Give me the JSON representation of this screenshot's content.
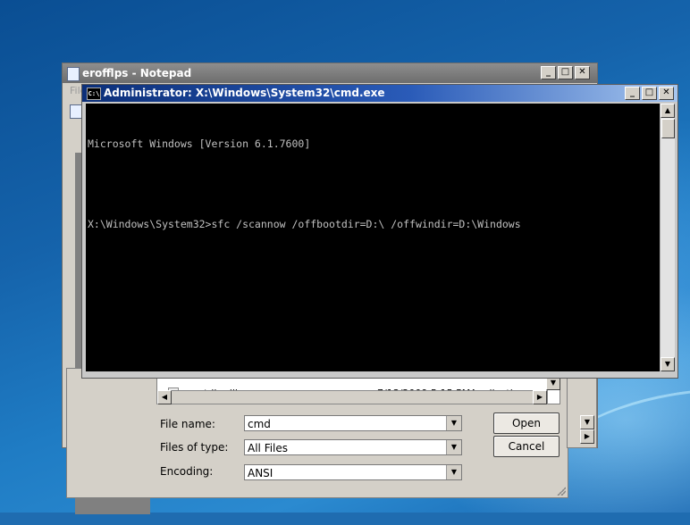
{
  "notepad": {
    "title": "erofflps - Notepad",
    "menu_first": "File"
  },
  "cmd": {
    "title": "Administrator: X:\\Windows\\System32\\cmd.exe",
    "lines": [
      "Microsoft Windows [Version 6.1.7600]",
      "",
      "X:\\Windows\\System32>sfc /scannow /offbootdir=D:\\ /offwindir=D:\\Windows"
    ],
    "buttons": {
      "minimize": "_",
      "maximize": "□",
      "close": "✕"
    }
  },
  "dialog": {
    "file_row": {
      "name": "cryptdlg.dll",
      "date": "7/13/2009 5:15 PM",
      "type": "Application exte..."
    },
    "file_name_label": "File name:",
    "file_name_value": "cmd",
    "files_of_type_label": "Files of type:",
    "files_of_type_value": "All Files",
    "encoding_label": "Encoding:",
    "encoding_value": "ANSI",
    "open_label": "Open",
    "cancel_label": "Cancel"
  },
  "colors": {
    "console_bg": "#000000",
    "console_text": "#c0c0c0",
    "cmd_title_active": "#0c2f79",
    "notepad_title_inactive": "#7a7a7a"
  }
}
